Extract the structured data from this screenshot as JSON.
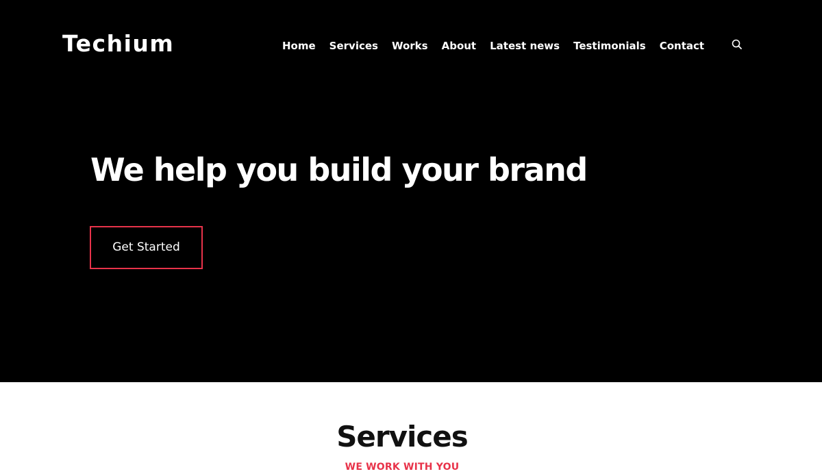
{
  "header": {
    "logo": "Techium",
    "nav": [
      {
        "label": "Home"
      },
      {
        "label": "Services"
      },
      {
        "label": "Works"
      },
      {
        "label": "About"
      },
      {
        "label": "Latest news"
      },
      {
        "label": "Testimonials"
      },
      {
        "label": "Contact"
      }
    ],
    "search_icon": "search-icon"
  },
  "hero": {
    "title": "We help you build your brand",
    "cta_label": "Get Started"
  },
  "services": {
    "title": "Services",
    "subtitle": "WE WORK WITH YOU"
  },
  "colors": {
    "hero_bg": "#000000",
    "accent": "#e8334a",
    "text_light": "#ffffff",
    "text_dark": "#111111"
  }
}
